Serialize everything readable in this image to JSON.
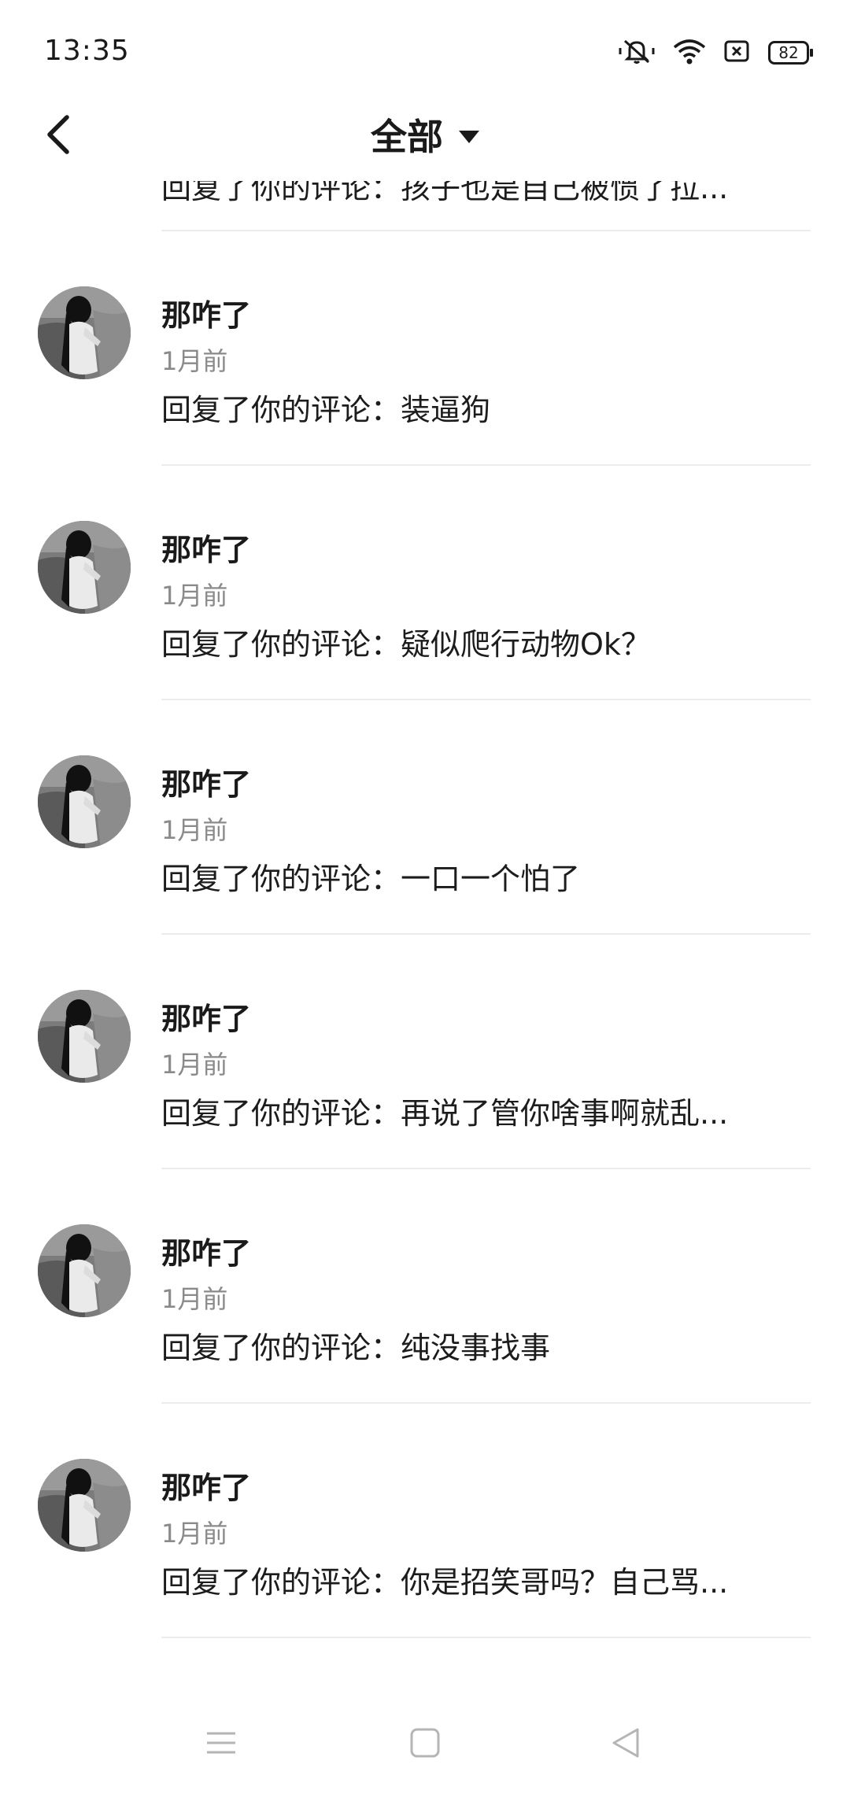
{
  "status": {
    "time": "13:35",
    "battery": "82",
    "icons": [
      "mute-icon",
      "wifi-icon",
      "sim-icon",
      "battery-icon"
    ]
  },
  "header": {
    "title": "全部",
    "back_icon": "chevron-left-icon",
    "dropdown_icon": "caret-down-icon"
  },
  "clipped_comment": "回复了你的评论：孩子也是自己被惯了拉...",
  "notifications": [
    {
      "name": "那咋了",
      "time": "1月前",
      "comment": "回复了你的评论：装逼狗"
    },
    {
      "name": "那咋了",
      "time": "1月前",
      "comment": "回复了你的评论：疑似爬行动物Ok？"
    },
    {
      "name": "那咋了",
      "time": "1月前",
      "comment": "回复了你的评论：一口一个怕了"
    },
    {
      "name": "那咋了",
      "time": "1月前",
      "comment": "回复了你的评论：再说了管你啥事啊就乱..."
    },
    {
      "name": "那咋了",
      "time": "1月前",
      "comment": "回复了你的评论：纯没事找事"
    },
    {
      "name": "那咋了",
      "time": "1月前",
      "comment": "回复了你的评论：你是招笑哥吗？自己骂..."
    }
  ],
  "nav": {
    "menu_icon": "menu-icon",
    "home_icon": "square-home-icon",
    "back_icon": "triangle-back-icon"
  },
  "colors": {
    "text": "#1c1c1c",
    "secondary": "#8a8a8a",
    "divider": "#ececec",
    "background": "#ffffff"
  }
}
